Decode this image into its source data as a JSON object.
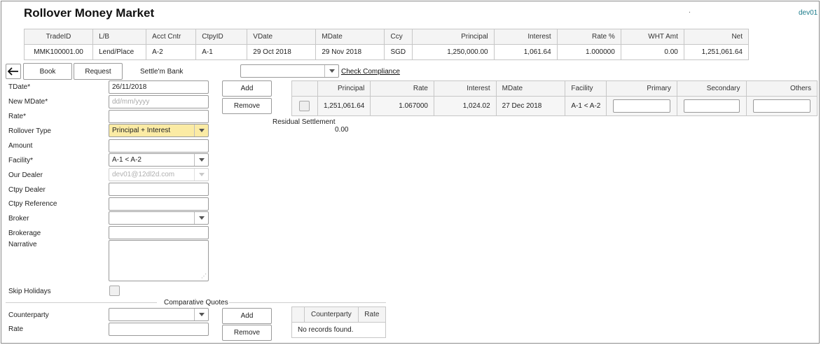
{
  "header": {
    "title": "Rollover Money Market",
    "dot": ".",
    "user": "dev01"
  },
  "summary": {
    "columns": [
      "TradeID",
      "L/B",
      "Acct Cntr",
      "CtpyID",
      "VDate",
      "MDate",
      "Ccy",
      "Principal",
      "Interest",
      "Rate %",
      "WHT Amt",
      "Net"
    ],
    "row": [
      "MMK100001.00",
      "Lend/Place",
      "A-2",
      "A-1",
      "29 Oct 2018",
      "29 Nov 2018",
      "SGD",
      "1,250,000.00",
      "1,061.64",
      "1.000000",
      "0.00",
      "1,251,061.64"
    ]
  },
  "toolbar": {
    "back_icon": "arrow-left-icon",
    "book": "Book",
    "request": "Request",
    "settle_label": "Settle'm Bank",
    "check_compliance": "Check Compliance"
  },
  "form": {
    "tdate_label": "TDate*",
    "tdate_value": "26/11/2018",
    "new_mdate_label": "New MDate*",
    "new_mdate_placeholder": "dd/mm/yyyy",
    "rate_label": "Rate*",
    "rollover_type_label": "Rollover Type",
    "rollover_type_value": "Principal + Interest",
    "amount_label": "Amount",
    "facility_label": "Facility*",
    "facility_value": "A-1 < A-2",
    "our_dealer_label": "Our Dealer",
    "our_dealer_value": "dev01@12dl2d.com",
    "ctpy_dealer_label": "Ctpy Dealer",
    "ctpy_reference_label": "Ctpy Reference",
    "broker_label": "Broker",
    "brokerage_label": "Brokerage",
    "narrative_label": "Narrative",
    "skip_holidays_label": "Skip Holidays"
  },
  "settlement": {
    "add": "Add",
    "remove": "Remove",
    "columns": [
      "Principal",
      "Rate",
      "Interest",
      "MDate",
      "Facility",
      "Primary",
      "Secondary",
      "Others"
    ],
    "row": [
      "1,251,061.64",
      "1.067000",
      "1,024.02",
      "27 Dec 2018",
      "A-1 < A-2"
    ],
    "residual_label": "Residual Settlement",
    "residual_value": "0.00"
  },
  "quotes": {
    "title": "Comparative Quotes",
    "counterparty_label": "Counterparty",
    "rate_label": "Rate",
    "add": "Add",
    "remove": "Remove",
    "columns": [
      "Counterparty",
      "Rate"
    ],
    "empty": "No records found."
  }
}
